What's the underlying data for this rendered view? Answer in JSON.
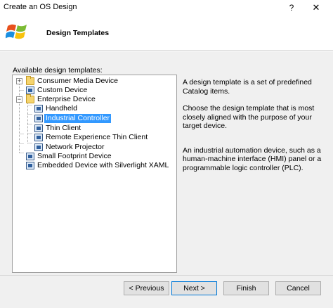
{
  "window": {
    "title": "Create an OS Design",
    "help_label": "?",
    "close_label": "✕"
  },
  "header": {
    "heading": "Design Templates"
  },
  "templates": {
    "label": "Available design templates:",
    "items": [
      {
        "label": "Consumer Media Device",
        "level": 0,
        "type": "folder",
        "expander": "+"
      },
      {
        "label": "Custom Device",
        "level": 0,
        "type": "device"
      },
      {
        "label": "Enterprise Device",
        "level": 0,
        "type": "folder",
        "expander": "−"
      },
      {
        "label": "Handheld",
        "level": 1,
        "type": "device"
      },
      {
        "label": "Industrial Controller",
        "level": 1,
        "type": "device",
        "selected": true
      },
      {
        "label": "Thin Client",
        "level": 1,
        "type": "device"
      },
      {
        "label": "Remote Experience Thin Client",
        "level": 1,
        "type": "device"
      },
      {
        "label": "Network Projector",
        "level": 1,
        "type": "device"
      },
      {
        "label": "Small Footprint Device",
        "level": 0,
        "type": "device"
      },
      {
        "label": "Embedded Device with Silverlight XAML",
        "level": 0,
        "type": "device"
      }
    ]
  },
  "description": {
    "p1": "A design template is a set of predefined Catalog items.",
    "p2": "Choose the design template that is most closely aligned with the purpose of your target device.",
    "p3": "An industrial automation device, such as a human-machine interface (HMI) panel or a programmable logic controller (PLC)."
  },
  "buttons": {
    "previous": "< Previous",
    "next": "Next >",
    "finish": "Finish",
    "cancel": "Cancel"
  }
}
